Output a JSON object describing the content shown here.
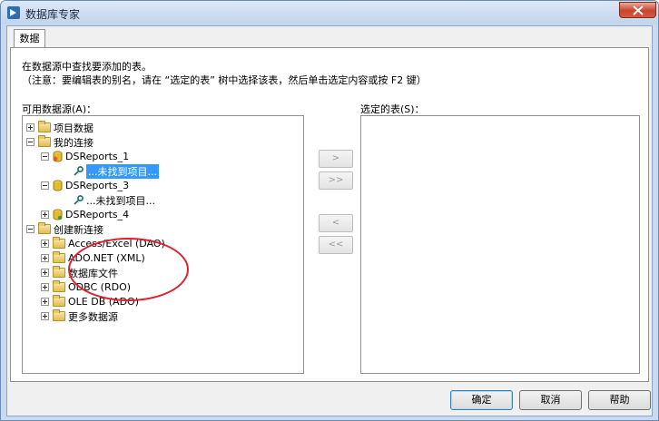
{
  "window": {
    "title": "数据库专家"
  },
  "tabs": [
    {
      "label": "数据"
    }
  ],
  "instructions": {
    "line1": "在数据源中查找要添加的表。",
    "line2": "（注意：要编辑表的别名，请在 “选定的表” 树中选择该表，然后单击选定内容或按 F2 键）"
  },
  "available": {
    "label": "可用数据源(A)：",
    "tree": [
      {
        "label": "项目数据",
        "expander": "plus",
        "icon": "folder-icon"
      },
      {
        "label": "我的连接",
        "expander": "minus",
        "icon": "folder-icon"
      },
      {
        "label": "DSReports_1",
        "expander": "minus",
        "icon": "database-icon"
      },
      {
        "label": "...未找到项目...",
        "icon": "key-icon",
        "selected": true
      },
      {
        "label": "DSReports_3",
        "expander": "minus",
        "icon": "database-icon"
      },
      {
        "label": "...未找到项目...",
        "icon": "key-icon"
      },
      {
        "label": "DSReports_4",
        "expander": "plus",
        "icon": "database-icon"
      },
      {
        "label": "创建新连接",
        "expander": "minus",
        "icon": "folder-icon"
      },
      {
        "label": "Access/Excel (DAO)",
        "expander": "plus",
        "icon": "folder-icon"
      },
      {
        "label": "ADO.NET (XML)",
        "expander": "plus",
        "icon": "folder-icon"
      },
      {
        "label": "数据库文件",
        "expander": "plus",
        "icon": "folder-icon"
      },
      {
        "label": "ODBC (RDO)",
        "expander": "plus",
        "icon": "folder-icon"
      },
      {
        "label": "OLE DB (ADO)",
        "expander": "plus",
        "icon": "folder-icon"
      },
      {
        "label": "更多数据源",
        "expander": "plus",
        "icon": "folder-icon"
      }
    ]
  },
  "selected_tables": {
    "label": "选定的表(S)："
  },
  "transfer_buttons": {
    "add": ">",
    "add_all": ">>",
    "remove": "<",
    "remove_all": "<<"
  },
  "footer": {
    "ok": "确定",
    "cancel": "取消",
    "help": "帮助"
  },
  "colors": {
    "selection": "#3399ff",
    "highlight_circle": "#e0212b",
    "close_button": "#c9442d"
  }
}
